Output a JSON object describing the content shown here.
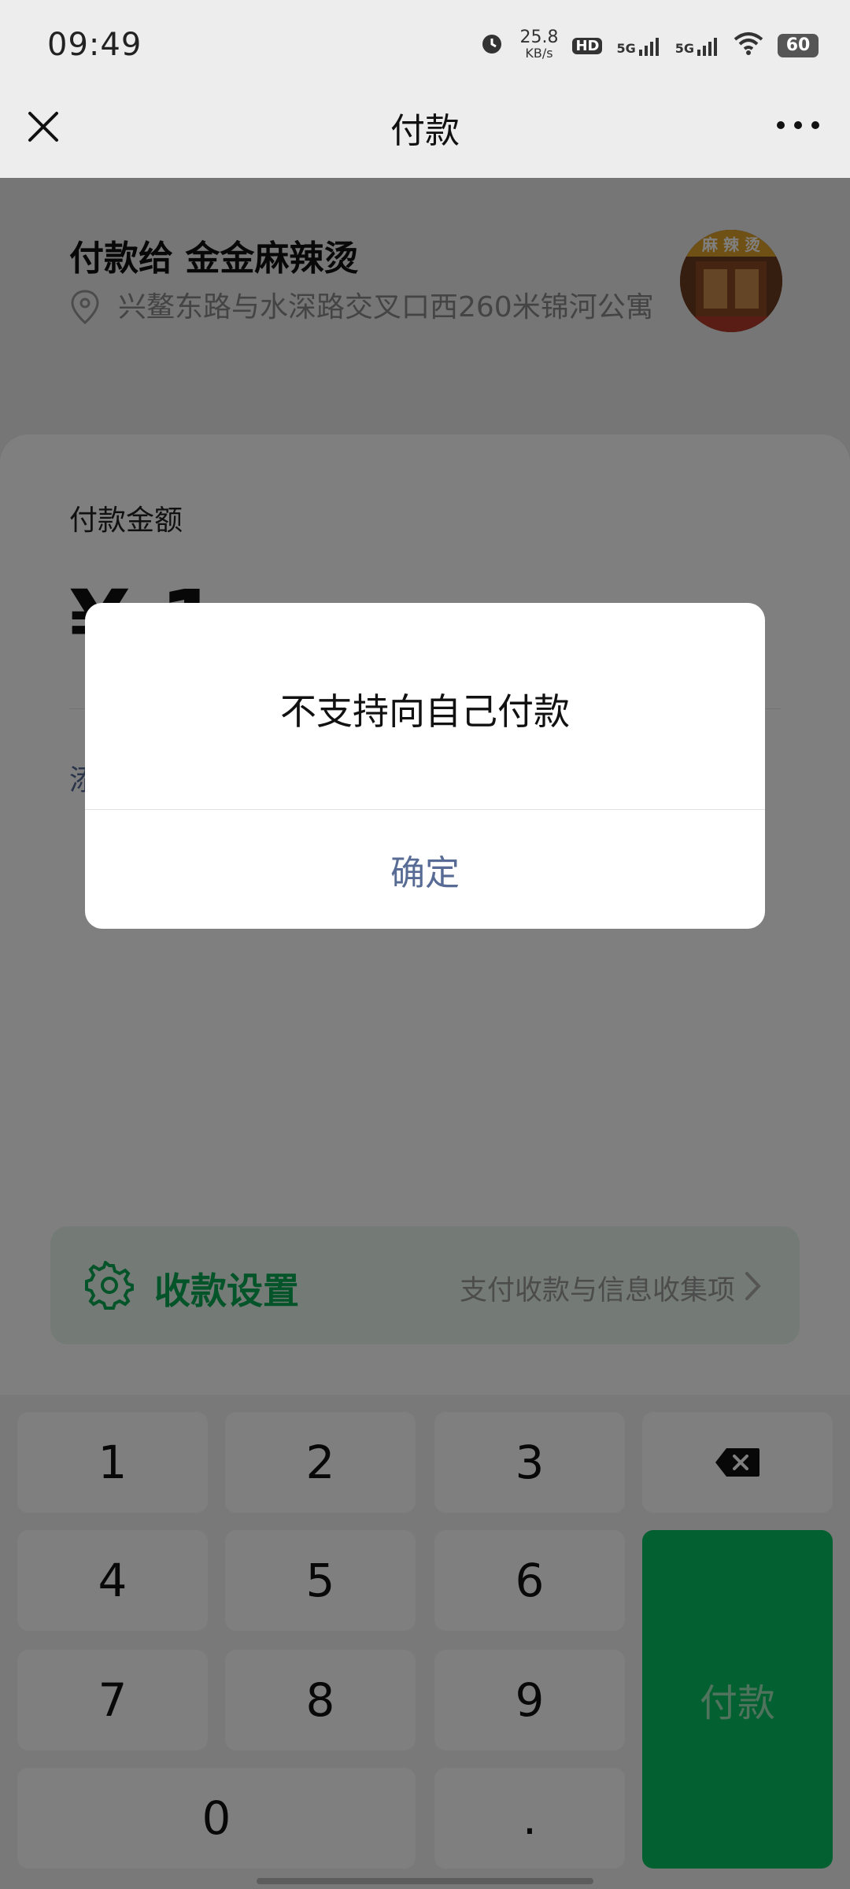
{
  "status_bar": {
    "time": "09:49",
    "net_speed_value": "25.8",
    "net_speed_unit": "KB/s",
    "hd_label": "HD",
    "signal_1": "5G",
    "signal_2": "5G",
    "battery": "60"
  },
  "nav": {
    "title": "付款"
  },
  "merchant": {
    "name": "付款给 金金麻辣烫",
    "address": "兴鳌东路与水深路交叉口西260米锦河公寓",
    "avatar_sign": "麻 辣 烫"
  },
  "payment": {
    "amount_label": "付款金额",
    "amount_value": "¥ 1",
    "remark_link": "添"
  },
  "settings_bar": {
    "label": "收款设置",
    "description": "支付收款与信息收集项"
  },
  "keypad": {
    "keys": [
      "1",
      "2",
      "3",
      "4",
      "5",
      "6",
      "7",
      "8",
      "9",
      "0",
      "."
    ],
    "pay_label": "付款"
  },
  "dialog": {
    "message": "不支持向自己付款",
    "confirm_label": "确定"
  },
  "colors": {
    "brand_green": "#07c160",
    "link_blue": "#576b95",
    "overlay": "rgba(0,0,0,0.5)"
  }
}
